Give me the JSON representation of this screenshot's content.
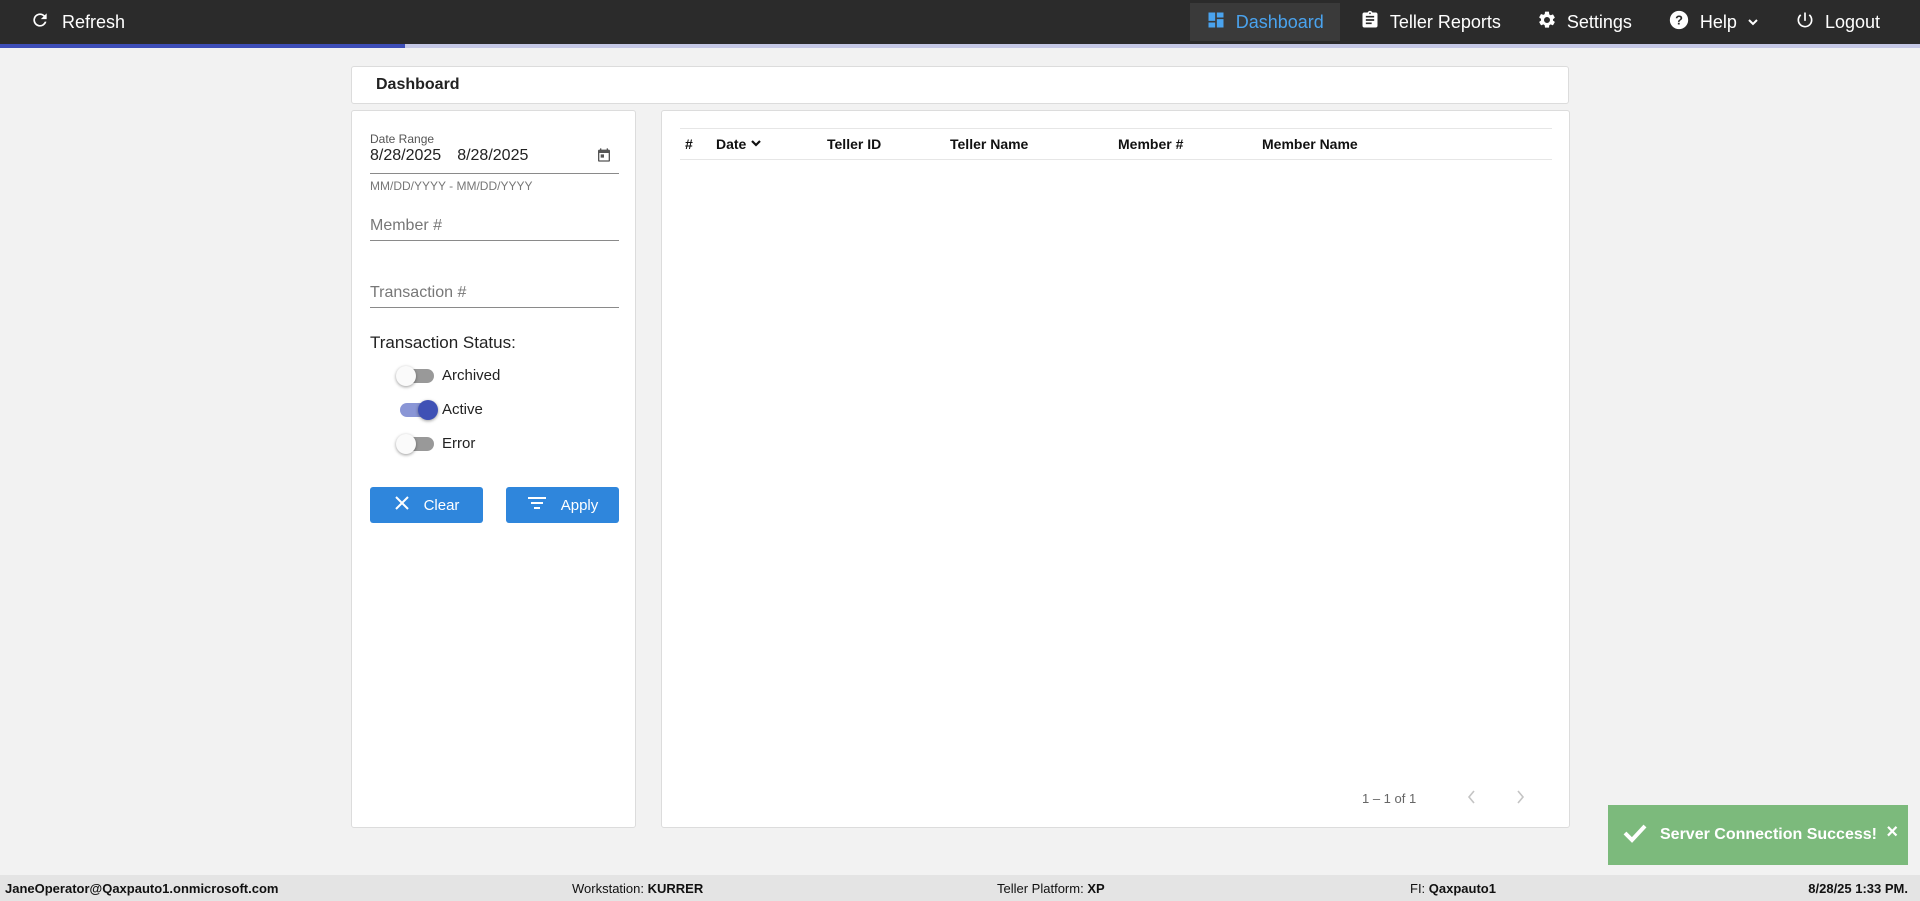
{
  "topbar": {
    "refresh_label": "Refresh",
    "nav": [
      {
        "label": "Dashboard",
        "icon": "dashboard-icon",
        "active": true
      },
      {
        "label": "Teller Reports",
        "icon": "clipboard-icon"
      },
      {
        "label": "Settings",
        "icon": "gear-icon"
      },
      {
        "label": "Help",
        "icon": "help-icon"
      },
      {
        "label": "Logout",
        "icon": "power-icon"
      }
    ]
  },
  "breadcrumb": {
    "title": "Dashboard"
  },
  "filters": {
    "date_range_label": "Date Range",
    "date_start": "8/28/2025",
    "date_end": "8/28/2025",
    "date_hint": "MM/DD/YYYY - MM/DD/YYYY",
    "member_placeholder": "Member #",
    "transaction_placeholder": "Transaction #",
    "status_title": "Transaction Status:",
    "statuses": [
      {
        "label": "Archived",
        "on": false
      },
      {
        "label": "Active",
        "on": true
      },
      {
        "label": "Error",
        "on": false
      }
    ],
    "clear_label": "Clear",
    "apply_label": "Apply"
  },
  "table": {
    "columns": [
      "#",
      "Date",
      "Teller ID",
      "Teller Name",
      "Member #",
      "Member Name"
    ],
    "rows": [],
    "pagination": "1 – 1 of 1"
  },
  "toast": {
    "message": "Server Connection Success!",
    "close": "×"
  },
  "footer": {
    "user": "JaneOperator@Qaxpauto1.onmicrosoft.com",
    "workstation_label": "Workstation: ",
    "workstation": "KURRER",
    "platform_label": "Teller Platform: ",
    "platform": "XP",
    "fi_label": "FI: ",
    "fi": "Qaxpauto1",
    "datetime": "8/28/25 1:33 PM."
  },
  "colors": {
    "topbar": "#2b2b2b",
    "accent": "#4aa3ee",
    "button": "#2f86dc",
    "toast": "#7cba7c",
    "progress": "#3d4db7"
  }
}
